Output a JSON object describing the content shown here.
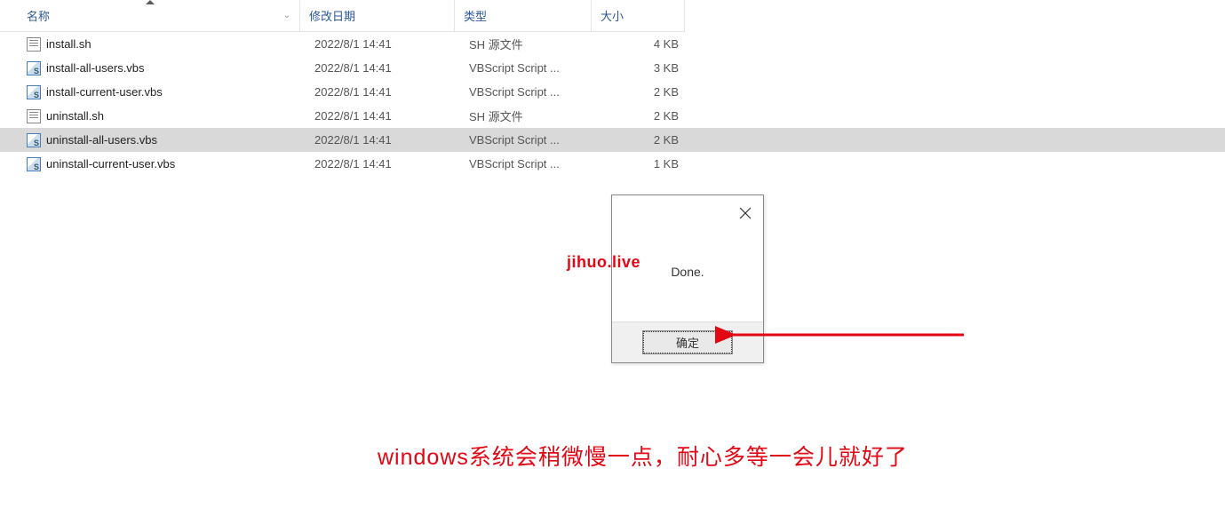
{
  "columns": {
    "name": "名称",
    "date": "修改日期",
    "type": "类型",
    "size": "大小"
  },
  "files": [
    {
      "icon": "sh",
      "name": "install.sh",
      "date": "2022/8/1 14:41",
      "type": "SH 源文件",
      "size": "4 KB",
      "selected": false
    },
    {
      "icon": "vbs",
      "name": "install-all-users.vbs",
      "date": "2022/8/1 14:41",
      "type": "VBScript Script ...",
      "size": "3 KB",
      "selected": false
    },
    {
      "icon": "vbs",
      "name": "install-current-user.vbs",
      "date": "2022/8/1 14:41",
      "type": "VBScript Script ...",
      "size": "2 KB",
      "selected": false
    },
    {
      "icon": "sh",
      "name": "uninstall.sh",
      "date": "2022/8/1 14:41",
      "type": "SH 源文件",
      "size": "2 KB",
      "selected": false
    },
    {
      "icon": "vbs",
      "name": "uninstall-all-users.vbs",
      "date": "2022/8/1 14:41",
      "type": "VBScript Script ...",
      "size": "2 KB",
      "selected": true
    },
    {
      "icon": "vbs",
      "name": "uninstall-current-user.vbs",
      "date": "2022/8/1 14:41",
      "type": "VBScript Script ...",
      "size": "1 KB",
      "selected": false
    }
  ],
  "dialog": {
    "message": "Done.",
    "ok": "确定"
  },
  "watermark": "jihuo.live",
  "annotation": "windows系统会稍微慢一点，耐心多等一会儿就好了"
}
